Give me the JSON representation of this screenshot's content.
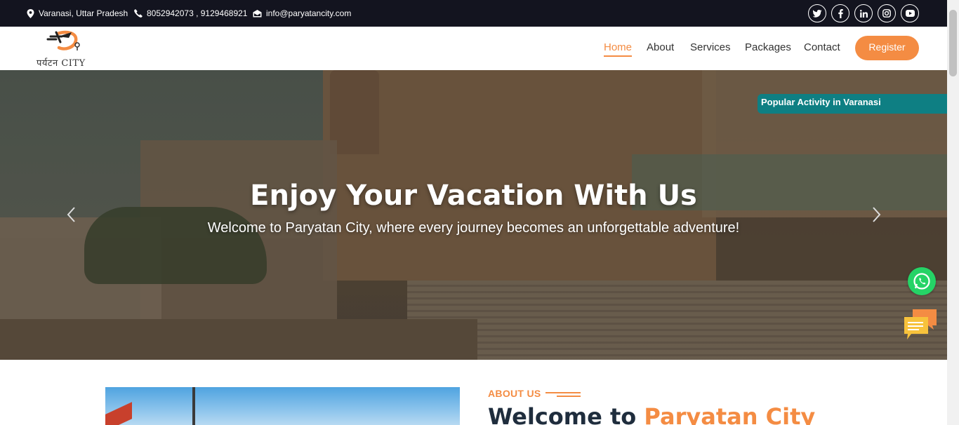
{
  "topbar": {
    "location": "Varanasi, Uttar Pradesh",
    "phone": "8052942073 , 9129468921",
    "email": "info@paryatancity.com",
    "social_icons": [
      "twitter-icon",
      "facebook-icon",
      "linkedin-icon",
      "instagram-icon",
      "youtube-icon"
    ]
  },
  "logo": {
    "text": "पर्यटन CITY"
  },
  "nav": {
    "items": [
      "Home",
      "About",
      "Services",
      "Packages",
      "Contact"
    ],
    "active": "Home",
    "register_label": "Register"
  },
  "hero": {
    "title": "Enjoy Your Vacation With Us",
    "subtitle": "Welcome to Paryatan City, where every journey becomes an unforgettable adventure!",
    "popular_tab": "Popular Activity in Varanasi"
  },
  "about": {
    "label": "ABOUT US",
    "heading_prefix": "Welcome to ",
    "heading_accent": "Paryatan City"
  },
  "colors": {
    "accent": "#f48c43",
    "topbar_bg": "#13141f",
    "teal": "#0e7f83",
    "heading": "#1f2d3d",
    "whatsapp": "#25d366"
  }
}
